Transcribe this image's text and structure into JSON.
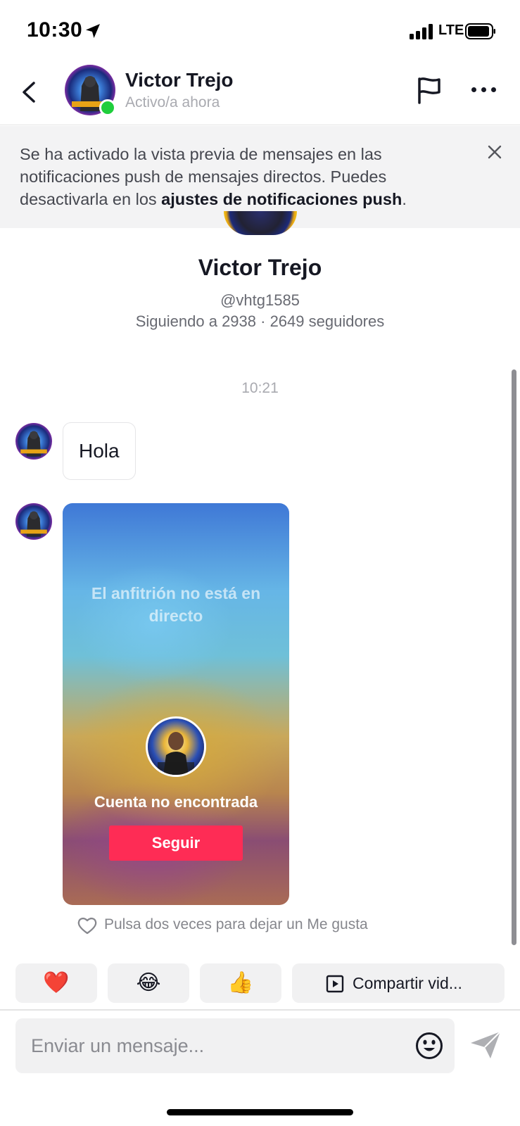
{
  "status_bar": {
    "time": "10:30",
    "network": "LTE",
    "icons": [
      "location-arrow-icon",
      "signal-icon",
      "battery-icon"
    ]
  },
  "header": {
    "name": "Victor Trejo",
    "status": "Activo/a ahora",
    "icons": [
      "back-chevron-icon",
      "flag-icon",
      "more-icon"
    ],
    "online_color": "#1fce3c"
  },
  "banner": {
    "text_before": "Se ha activado la vista previa de mensajes en las notificaciones push de mensajes directos. Puedes desactivarla en los ",
    "link_text": "ajustes de notificaciones push",
    "text_after": ".",
    "close_icon": "close-icon"
  },
  "profile": {
    "name": "Victor Trejo",
    "handle": "@vhtg1585",
    "stats": "Siguiendo a 2938 · 2649 seguidores"
  },
  "conversation": {
    "timestamp": "10:21",
    "messages": [
      {
        "type": "text",
        "text": "Hola"
      },
      {
        "type": "live_share",
        "live_status": "El anfitrión no está en directo",
        "account_text": "Cuenta no encontrada",
        "button_label": "Seguir"
      }
    ],
    "like_hint": "Pulsa dos veces para dejar un Me gusta"
  },
  "quick_replies": {
    "emojis": [
      "❤️",
      "😂",
      "👍"
    ],
    "share_label": "Compartir vid..."
  },
  "composer": {
    "placeholder": "Enviar un mensaje..."
  },
  "colors": {
    "accent": "#fe2c55",
    "online": "#1fce3c"
  }
}
